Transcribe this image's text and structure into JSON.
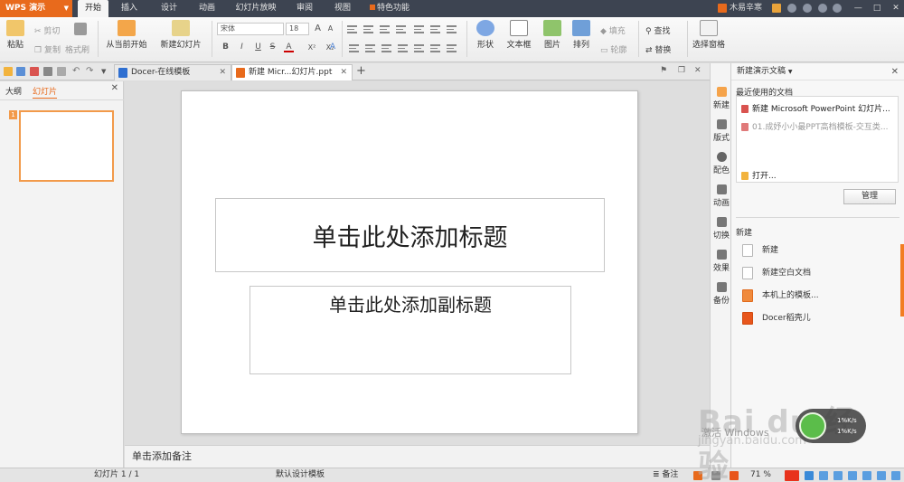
{
  "titlebar": {
    "app_name": "WPS 演示",
    "menu_tabs": [
      "开始",
      "插入",
      "设计",
      "动画",
      "幻灯片放映",
      "审阅",
      "视图",
      "特色功能"
    ],
    "user_name": "木易辛寒",
    "window_controls": [
      "—",
      "□",
      "✕"
    ]
  },
  "ribbon": {
    "paste": "粘贴",
    "cut": "剪切",
    "copy": "复制",
    "format_painter": "格式刷",
    "from_current": "从当前开始",
    "new_slide": "新建幻灯片",
    "font_name": "宋体",
    "font_size": "18",
    "shape": "形状",
    "textbox": "文本框",
    "picture": "图片",
    "arrange": "排列",
    "fill": "填充",
    "outline": "轮廓",
    "find": "查找",
    "replace": "替换",
    "selection_pane": "选择窗格",
    "format_glyphs": {
      "grow": "A",
      "shrink": "A",
      "bold": "B",
      "italic": "I",
      "underline": "U",
      "strike": "S",
      "font_color": "A",
      "superscript": "X²",
      "subscript": "X₂",
      "clear": "A"
    }
  },
  "tabs": {
    "docer": "Docer-在线模板",
    "current": "新建 Micr...幻灯片.ppt",
    "add": "+"
  },
  "left_panel": {
    "outline_tab": "大纲",
    "slides_tab": "幻灯片",
    "close": "✕",
    "thumb_index": "1"
  },
  "slide": {
    "title": "单击此处添加标题",
    "subtitle": "单击此处添加副标题"
  },
  "notes": "单击添加备注",
  "side_tools": [
    "新建",
    "版式",
    "配色",
    "动画",
    "切换",
    "效果",
    "备份"
  ],
  "task_pane": {
    "title": "新建演示文稿",
    "recent_title": "最近使用的文档",
    "recent_files": [
      "新建 Microsoft PowerPoint 幻灯片...",
      "01.成妤小小最PPT高档模板-交互类..."
    ],
    "open": "打开...",
    "manage": "管理",
    "new_title": "新建",
    "new_items": [
      "新建",
      "新建空白文档",
      "本机上的模板...",
      "Docer稻壳儿"
    ]
  },
  "statusbar": {
    "slide_count": "幻灯片 1 / 1",
    "template": "默认设计模板",
    "notes": "备注",
    "zoom": "71 %"
  },
  "overlay": {
    "watermark": "Bai du 经验",
    "watermark_url": "jingyan.baidu.com",
    "activate": "激活 Windows",
    "speed_up": "1%K/s",
    "speed_down": "1%K/s"
  },
  "colors": {
    "accent": "#e86a1c",
    "titlebar": "#3d4451",
    "thumb_border": "#f29a4a"
  }
}
